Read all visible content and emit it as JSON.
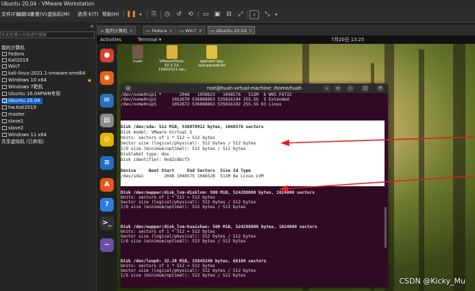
{
  "window": {
    "title": "Ubuntu 20.04 - VMware Workstation"
  },
  "menu": {
    "items": [
      "文件(F)",
      "编辑(E)",
      "查看(V)",
      "虚拟机(M)",
      "选项卡(T)",
      "帮助(H)"
    ]
  },
  "toolbar": {
    "buttons": [
      "pause-icon",
      "send-ctrl-alt-del-icon",
      "snapshot-icon",
      "revert-icon",
      "manage-snapshots-icon",
      "view-fullscreen-icon",
      "unity-icon",
      "thumbnail-icon",
      "stretch-icon",
      "console-icon",
      "fit-icon"
    ]
  },
  "library": {
    "search_placeholder": "在此处键入内容进行搜索",
    "root": "我的计算机",
    "items": [
      "Fedora",
      "Kali2019",
      "Win7",
      "kali-linux-2021.1-vmware-amd64",
      "Windows 10 x64",
      "Windows 7靶机",
      "Ubuntu 16.04PWN专用",
      "Ubuntu 20.04",
      "hw.Kali2019",
      "master",
      "slave1",
      "slave2",
      "Windows 11 x64"
    ],
    "shared": "共享虚拟机 (已弃用)"
  },
  "tabs": [
    {
      "label": "我的计算机"
    },
    {
      "label": "Fedora"
    },
    {
      "label": "Win7"
    },
    {
      "label": "Ubuntu 20.04"
    }
  ],
  "ubuntu": {
    "activities": "Activities",
    "app_menu": "Terminal ▾",
    "clock": "7月20日  13:25",
    "desktop_icons": [
      {
        "label": "huah",
        "color": "#6e5a4a"
      },
      {
        "label": "VMwareTools-10.3.22-15902021.tar.gz",
        "color": "#e0b040"
      },
      {
        "label": "openwrt-ipq-sysupgrade.bin",
        "color": "#e0c040"
      }
    ],
    "dock": [
      {
        "name": "chrome-icon",
        "color": "#d9412f",
        "glyph": "●"
      },
      {
        "name": "firefox-icon",
        "color": "#e2621b",
        "glyph": "◉"
      },
      {
        "name": "thunderbird-icon",
        "color": "#2a6fc0",
        "glyph": "✉"
      },
      {
        "name": "files-icon",
        "color": "#8a8a8a",
        "glyph": "▤"
      },
      {
        "name": "rhythmbox-icon",
        "color": "#e6b400",
        "glyph": "◎"
      },
      {
        "name": "writer-icon",
        "color": "#1f6fc5",
        "glyph": "≡"
      },
      {
        "name": "software-icon",
        "color": "#e95420",
        "glyph": "A"
      },
      {
        "name": "help-icon",
        "color": "#2a7de1",
        "glyph": "?"
      },
      {
        "name": "terminal-icon",
        "color": "#333333",
        "glyph": ">_"
      },
      {
        "name": "app-icon",
        "color": "#6a4fa3",
        "glyph": "~"
      }
    ]
  },
  "terminal": {
    "title": "root@huah-virtual-machine: /home/huah",
    "lines_top": [
      "/dev/nvme0n1p1 *       2048   1058623   1048576   512M  b W95 FAT32",
      "/dev/nvme0n1p2      1052670 536868863 535816194 255.5G  5 Extended",
      "/dev/nvme0n1p5      1052672 536868863 535816192 255.5G 83 Linux"
    ],
    "highlight_lines": [
      "Disk /dev/sda: 512 MiB, 536870912 bytes, 1048576 sectors",
      "Disk model: VMware Virtual S",
      "Units: sectors of 1 * 512 = 512 bytes",
      "Sector size (logical/physical): 512 bytes / 512 bytes",
      "I/O size (minimum/optimal): 512 bytes / 512 bytes",
      "Disklabel type: dos",
      "Disk identifier: 0xd2c8bcf3",
      "",
      "Device     Boot Start     End Sectors  Size Id Type",
      "/dev/sda1        2048 1048575 1046528  511M 8e Linux LVM"
    ],
    "lines_bottom": [
      "Disk /dev/mapper/disk_lvm-disklvm: 500 MiB, 524288000 bytes, 1024000 sectors",
      "Units: sectors of 1 * 512 = 512 bytes",
      "Sector size (logical/physical): 512 bytes / 512 bytes",
      "I/O size (minimum/optimal): 512 bytes / 512 bytes",
      "",
      "",
      "Disk /dev/mapper/disk_lvm-kuaizhao: 500 MiB, 524288000 bytes, 1024000 sectors",
      "Units: sectors of 1 * 512 = 512 bytes",
      "Sector size (logical/physical): 512 bytes / 512 bytes",
      "I/O size (minimum/optimal): 512 bytes / 512 bytes",
      "",
      "",
      "Disk /dev/loop8: 32.28 MiB, 33845248 bytes, 66104 sectors",
      "Units: sectors of 1 * 512 = 512 bytes",
      "Sector size (logical/physical): 512 bytes / 512 bytes",
      "I/O size (minimum/optimal): 512 bytes / 512 bytes"
    ]
  },
  "annotation": {
    "arrow_color": "#e02020"
  },
  "watermark": "CSDN @Kicky_Mu"
}
